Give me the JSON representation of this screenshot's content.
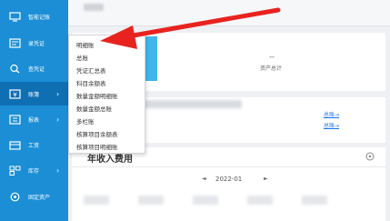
{
  "sidebar": {
    "items": [
      {
        "label": "智能记账",
        "icon": "desktop-icon",
        "has_submenu": false
      },
      {
        "label": "录凭证",
        "icon": "voucher-icon",
        "has_submenu": false
      },
      {
        "label": "查凭证",
        "icon": "search-voucher-icon",
        "has_submenu": false
      },
      {
        "label": "账簿",
        "icon": "ledger-icon",
        "has_submenu": true
      },
      {
        "label": "报表",
        "icon": "report-icon",
        "has_submenu": true
      },
      {
        "label": "工资",
        "icon": "salary-icon",
        "has_submenu": false
      },
      {
        "label": "库存",
        "icon": "inventory-icon",
        "has_submenu": true
      },
      {
        "label": "固定资产",
        "icon": "fixed-assets-icon",
        "has_submenu": false
      }
    ],
    "submenu_chevron": "›",
    "active_index": 3,
    "color": "#1b8ed6",
    "active_color": "#0f6fb3"
  },
  "ledger_menu": {
    "items": [
      "明细账",
      "总账",
      "凭证汇总表",
      "科目余额表",
      "数量金额明细账",
      "数量金额总账",
      "多栏账",
      "核算项目余额表",
      "核算项目明细账"
    ]
  },
  "assets_card": {
    "value": "--",
    "label": "资产总计",
    "tile_color": "#3fb7ea"
  },
  "links": {
    "first": "总账→",
    "second": "总账→"
  },
  "income_card": {
    "title": "年收入费用",
    "prev_arrow": "◄",
    "period": "2022-01",
    "next_arrow": "►"
  },
  "annotation": {
    "arrow_color": "#e8231f",
    "target": "明细账"
  }
}
